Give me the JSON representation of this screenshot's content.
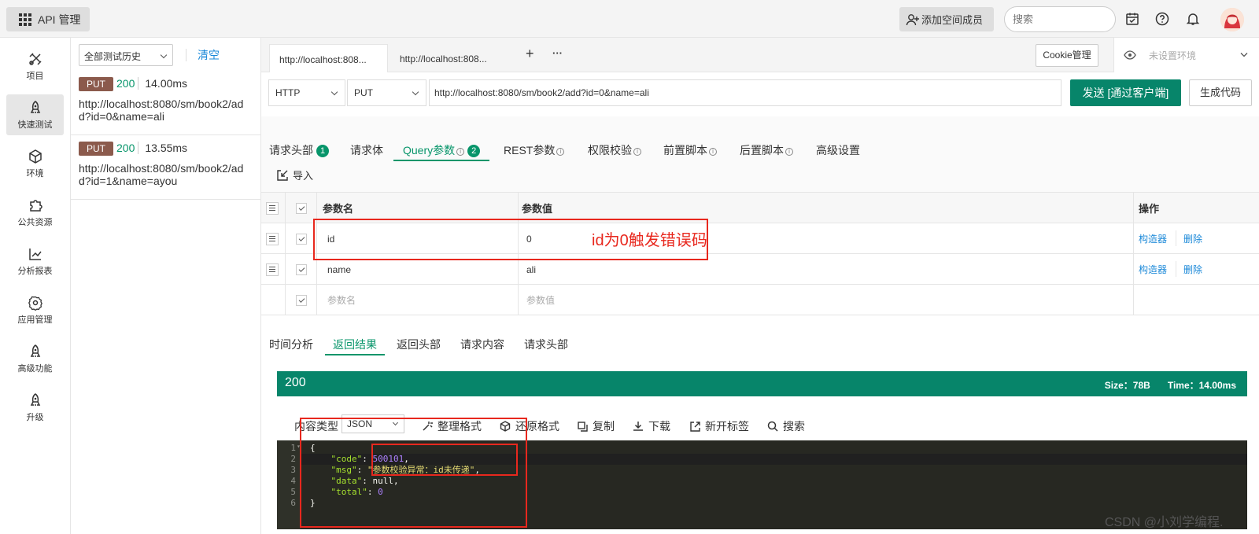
{
  "topbar": {
    "app_label": "API 管理",
    "add_member_label": "添加空间成员",
    "search_placeholder": "搜索"
  },
  "nav": {
    "items": [
      {
        "label": "项目",
        "icon": "project-icon"
      },
      {
        "label": "快速测试",
        "icon": "rocket-icon",
        "active": true
      },
      {
        "label": "环境",
        "icon": "cube-icon"
      },
      {
        "label": "公共资源",
        "icon": "puzzle-icon"
      },
      {
        "label": "分析报表",
        "icon": "chart-icon"
      },
      {
        "label": "应用管理",
        "icon": "gear-icon"
      },
      {
        "label": "高级功能",
        "icon": "rocket-icon"
      },
      {
        "label": "升级",
        "icon": "rocket-icon"
      }
    ]
  },
  "history": {
    "filter_value": "全部测试历史",
    "clear_label": "清空",
    "entries": [
      {
        "method": "PUT",
        "status": "200",
        "time": "14.00ms",
        "url": "http://localhost:8080/sm/book2/add?id=0&name=ali"
      },
      {
        "method": "PUT",
        "status": "200",
        "time": "13.55ms",
        "url": "http://localhost:8080/sm/book2/add?id=1&name=ayou"
      }
    ]
  },
  "tabs": {
    "items": [
      "http://localhost:808...",
      "http://localhost:808..."
    ],
    "add": "+",
    "more": "···",
    "cookie_label": "Cookie管理",
    "env_placeholder": "未设置环境"
  },
  "request": {
    "protocol": "HTTP",
    "method": "PUT",
    "url": "http://localhost:8080/sm/book2/add?id=0&name=ali",
    "send_label": "发送 [通过客户端]",
    "gen_code_label": "生成代码"
  },
  "subtabs": {
    "headers": "请求头部",
    "headers_count": "1",
    "body": "请求体",
    "query": "Query参数",
    "query_count": "2",
    "rest": "REST参数",
    "auth": "权限校验",
    "pre_script": "前置脚本",
    "post_script": "后置脚本",
    "advanced": "高级设置",
    "import_label": "导入"
  },
  "params": {
    "col_name": "参数名",
    "col_value": "参数值",
    "col_ops": "操作",
    "rows": [
      {
        "name": "id",
        "value": "0",
        "op1": "构造器",
        "op2": "删除"
      },
      {
        "name": "name",
        "value": "ali",
        "op1": "构造器",
        "op2": "删除"
      }
    ],
    "name_placeholder": "参数名",
    "value_placeholder": "参数值"
  },
  "annotation": "id为0触发错误码",
  "response": {
    "tabs": [
      "时间分析",
      "返回结果",
      "返回头部",
      "请求内容",
      "请求头部"
    ],
    "status": "200",
    "size": "Size：78B",
    "time": "Time：14.00ms",
    "content_type_label": "内容类型",
    "format_value": "JSON",
    "tools": [
      "整理格式",
      "还原格式",
      "复制",
      "下载",
      "新开标签",
      "搜索"
    ],
    "code_lines": [
      {
        "ln": "1",
        "text": "{"
      },
      {
        "ln": "2",
        "key": "\"code\"",
        "val": "500101",
        "val_type": "n"
      },
      {
        "ln": "3",
        "key": "\"msg\"",
        "val": "\"参数校验异常：id未传递\"",
        "val_type": "s"
      },
      {
        "ln": "4",
        "key": "\"data\"",
        "val": "null",
        "val_type": "p"
      },
      {
        "ln": "5",
        "key": "\"total\"",
        "val": "0",
        "val_type": "n",
        "last": true
      },
      {
        "ln": "6",
        "text": "}"
      }
    ]
  },
  "watermark": "CSDN @小刘学编程."
}
